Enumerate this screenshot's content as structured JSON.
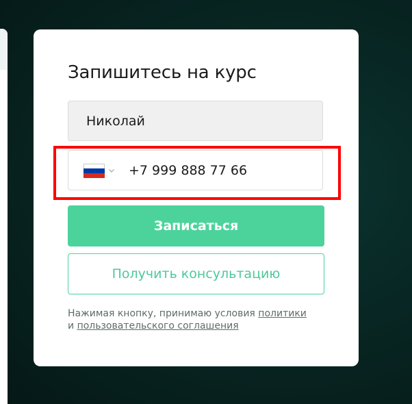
{
  "form": {
    "title": "Запишитесь на курс",
    "name_value": "Николай",
    "phone": {
      "country_flag": "russia-flag",
      "value": "+7 999 888 77 66"
    },
    "submit_label": "Записаться",
    "consult_label": "Получить консультацию",
    "consent": {
      "prefix": "Нажимая кнопку, принимаю условия ",
      "policy_link": "политики",
      "and": "и ",
      "agreement_link": "пользовательского соглашения"
    }
  },
  "colors": {
    "accent": "#4cd39c",
    "highlight": "#ff0000"
  }
}
